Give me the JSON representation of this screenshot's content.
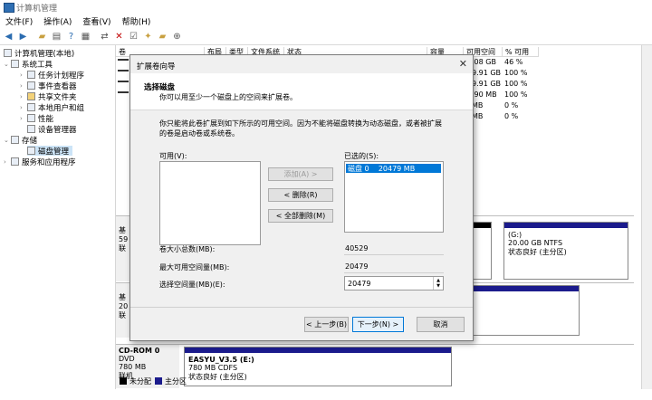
{
  "window": {
    "title": "计算机管理"
  },
  "menu": [
    "文件(F)",
    "操作(A)",
    "查看(V)",
    "帮助(H)"
  ],
  "toolbar_icons": [
    "back-icon",
    "forward-icon",
    "up-folder-icon",
    "properties-icon",
    "help-icon",
    "list-icon",
    "connect-icon",
    "delete-icon",
    "check-icon",
    "new-icon",
    "folder-icon",
    "zoom-icon"
  ],
  "tree": [
    {
      "label": "计算机管理(本地)",
      "level": 0,
      "expander": ""
    },
    {
      "label": "系统工具",
      "level": 1,
      "expander": "⌄"
    },
    {
      "label": "任务计划程序",
      "level": 2,
      "expander": "›"
    },
    {
      "label": "事件查看器",
      "level": 2,
      "expander": "›"
    },
    {
      "label": "共享文件夹",
      "level": 2,
      "expander": "›"
    },
    {
      "label": "本地用户和组",
      "level": 2,
      "expander": "›"
    },
    {
      "label": "性能",
      "level": 2,
      "expander": "›"
    },
    {
      "label": "设备管理器",
      "level": 2,
      "expander": ""
    },
    {
      "label": "存储",
      "level": 1,
      "expander": "⌄"
    },
    {
      "label": "磁盘管理",
      "level": 2,
      "expander": "",
      "selected": true
    },
    {
      "label": "服务和应用程序",
      "level": 1,
      "expander": "›"
    }
  ],
  "columns": [
    "卷",
    "布局",
    "类型",
    "文件系统",
    "状态",
    "容量",
    "可用空间",
    "% 可用"
  ],
  "volume_rows": [
    {
      "free": ".08 GB",
      "pct": "46 %"
    },
    {
      "free": "9.91 GB",
      "pct": "100 %"
    },
    {
      "free": "9.91 GB",
      "pct": "100 %"
    },
    {
      "free": ".90 MB",
      "pct": "100 %"
    },
    {
      "free": "MB",
      "pct": "0 %"
    },
    {
      "free": "MB",
      "pct": "0 %"
    }
  ],
  "disks": [
    {
      "header": [
        "基",
        "59",
        "联"
      ]
    },
    {
      "header": [
        "基",
        "20",
        "联"
      ]
    },
    {
      "header": [
        "CD-ROM 0",
        "DVD",
        "780 MB",
        "联机"
      ]
    }
  ],
  "partitions": {
    "g_drive": {
      "name": "(G:)",
      "size": "20.00 GB NTFS",
      "status": "状态良好 (主分区)"
    },
    "cd": {
      "name": "EASYU_V3.5 (E:)",
      "size": "780 MB CDFS",
      "status": "状态良好 (主分区)"
    }
  },
  "legend": [
    {
      "label": "未分配",
      "color": "#000000"
    },
    {
      "label": "主分区",
      "color": "#1b1b8c"
    }
  ],
  "dialog": {
    "title": "扩展卷向导",
    "heading": "选择磁盘",
    "subheading": "你可以用至少一个磁盘上的空间来扩展卷。",
    "description": "你只能将此卷扩展到如下所示的可用空间。因为不能将磁盘转换为动态磁盘，或者被扩展的卷是启动卷或系统卷。",
    "available_label": "可用(V):",
    "selected_label": "已选的(S):",
    "selected_items": [
      {
        "disk": "磁盘 0",
        "size": "20479 MB"
      }
    ],
    "add_button": "添加(A) >",
    "remove_button": "< 删除(R)",
    "remove_all_button": "< 全部删除(M)",
    "total_label": "卷大小总数(MB):",
    "total_value": "40529",
    "max_label": "最大可用空间量(MB):",
    "max_value": "20479",
    "select_label": "选择空间量(MB)(E):",
    "select_value": "20479",
    "back_button": "< 上一步(B)",
    "next_button": "下一步(N) >",
    "cancel_button": "取消"
  }
}
